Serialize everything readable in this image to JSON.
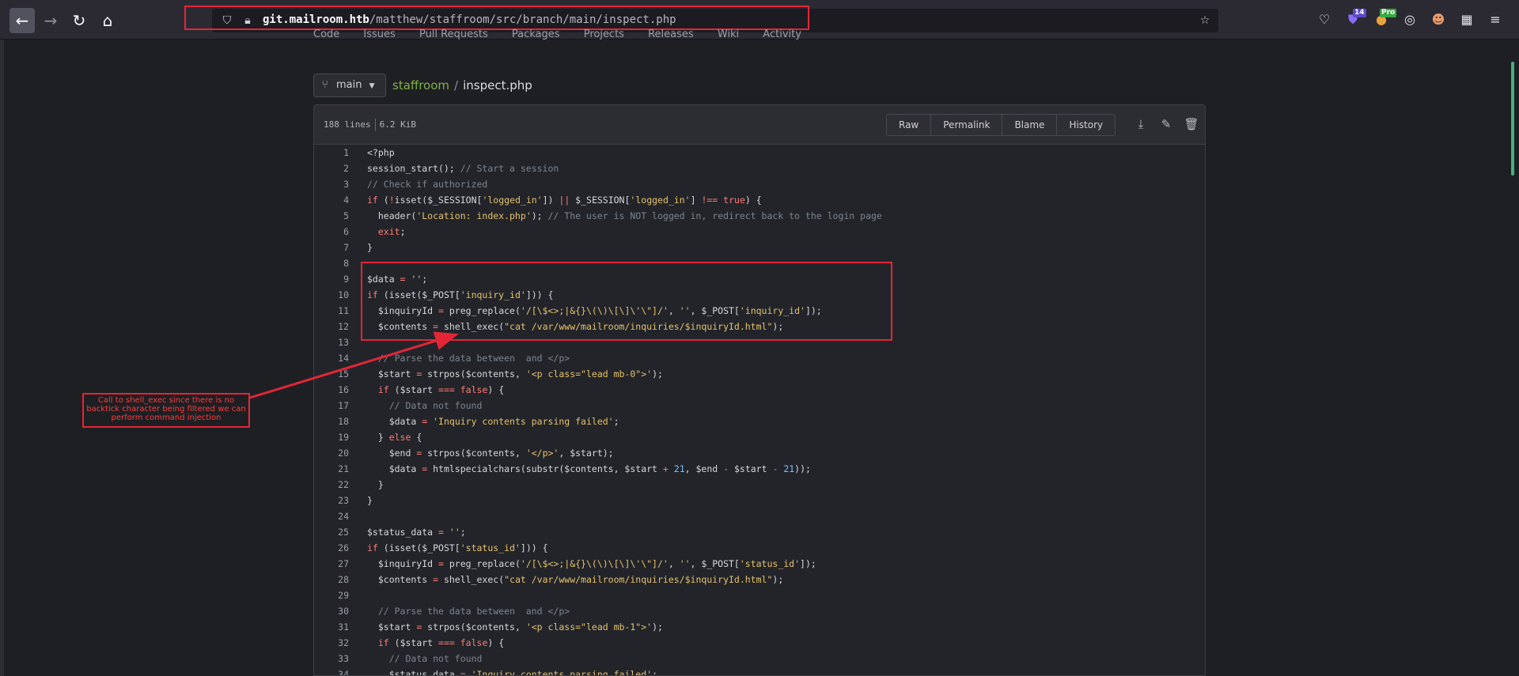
{
  "browser": {
    "url_host": "git.mailroom.htb",
    "url_path": "/matthew/staffroom/src/branch/main/inspect.php",
    "ext_badge_1": "14",
    "ext_badge_2": "Pro"
  },
  "repo_tabs": [
    "Code",
    "Issues",
    "Pull Requests",
    "Packages",
    "Projects",
    "Releases",
    "Wiki",
    "Activity"
  ],
  "branch": "main",
  "breadcrumb": {
    "repo": "staffroom",
    "sep": "/",
    "file": "inspect.php"
  },
  "file_info": {
    "lines": "188 lines",
    "size": "6.2 KiB"
  },
  "file_actions": [
    "Raw",
    "Permalink",
    "Blame",
    "History"
  ],
  "annotation": "Call to shell_exec since there is no backtick character being filtered we can perform command injection",
  "code_lines": [
    {
      "n": "1",
      "t": "<?php"
    },
    {
      "n": "2",
      "t": "session_start(); // Start a session"
    },
    {
      "n": "3",
      "t": "// Check if authorized"
    },
    {
      "n": "4",
      "t": "if (!isset($_SESSION['logged_in']) || $_SESSION['logged_in'] !== true) {"
    },
    {
      "n": "5",
      "t": "  header('Location: index.php'); // The user is NOT logged in, redirect back to the login page"
    },
    {
      "n": "6",
      "t": "  exit;"
    },
    {
      "n": "7",
      "t": "}"
    },
    {
      "n": "8",
      "t": ""
    },
    {
      "n": "9",
      "t": "$data = '';"
    },
    {
      "n": "10",
      "t": "if (isset($_POST['inquiry_id'])) {"
    },
    {
      "n": "11",
      "t": "  $inquiryId = preg_replace('/[\\$<>;|&{}\\(\\)\\[\\]\\'\\\"]/', '', $_POST['inquiry_id']);"
    },
    {
      "n": "12",
      "t": "  $contents = shell_exec(\"cat /var/www/mailroom/inquiries/$inquiryId.html\");"
    },
    {
      "n": "13",
      "t": ""
    },
    {
      "n": "14",
      "t": "  // Parse the data between  and </p>"
    },
    {
      "n": "15",
      "t": "  $start = strpos($contents, '<p class=\"lead mb-0\">');"
    },
    {
      "n": "16",
      "t": "  if ($start === false) {"
    },
    {
      "n": "17",
      "t": "    // Data not found"
    },
    {
      "n": "18",
      "t": "    $data = 'Inquiry contents parsing failed';"
    },
    {
      "n": "19",
      "t": "  } else {"
    },
    {
      "n": "20",
      "t": "    $end = strpos($contents, '</p>', $start);"
    },
    {
      "n": "21",
      "t": "    $data = htmlspecialchars(substr($contents, $start + 21, $end - $start - 21));"
    },
    {
      "n": "22",
      "t": "  }"
    },
    {
      "n": "23",
      "t": "}"
    },
    {
      "n": "24",
      "t": ""
    },
    {
      "n": "25",
      "t": "$status_data = '';"
    },
    {
      "n": "26",
      "t": "if (isset($_POST['status_id'])) {"
    },
    {
      "n": "27",
      "t": "  $inquiryId = preg_replace('/[\\$<>;|&{}\\(\\)\\[\\]\\'\\\"]/', '', $_POST['status_id']);"
    },
    {
      "n": "28",
      "t": "  $contents = shell_exec(\"cat /var/www/mailroom/inquiries/$inquiryId.html\");"
    },
    {
      "n": "29",
      "t": ""
    },
    {
      "n": "30",
      "t": "  // Parse the data between  and </p>"
    },
    {
      "n": "31",
      "t": "  $start = strpos($contents, '<p class=\"lead mb-1\">');"
    },
    {
      "n": "32",
      "t": "  if ($start === false) {"
    },
    {
      "n": "33",
      "t": "    // Data not found"
    },
    {
      "n": "34",
      "t": "    $status_data = 'Inquiry contents parsing failed';"
    }
  ]
}
